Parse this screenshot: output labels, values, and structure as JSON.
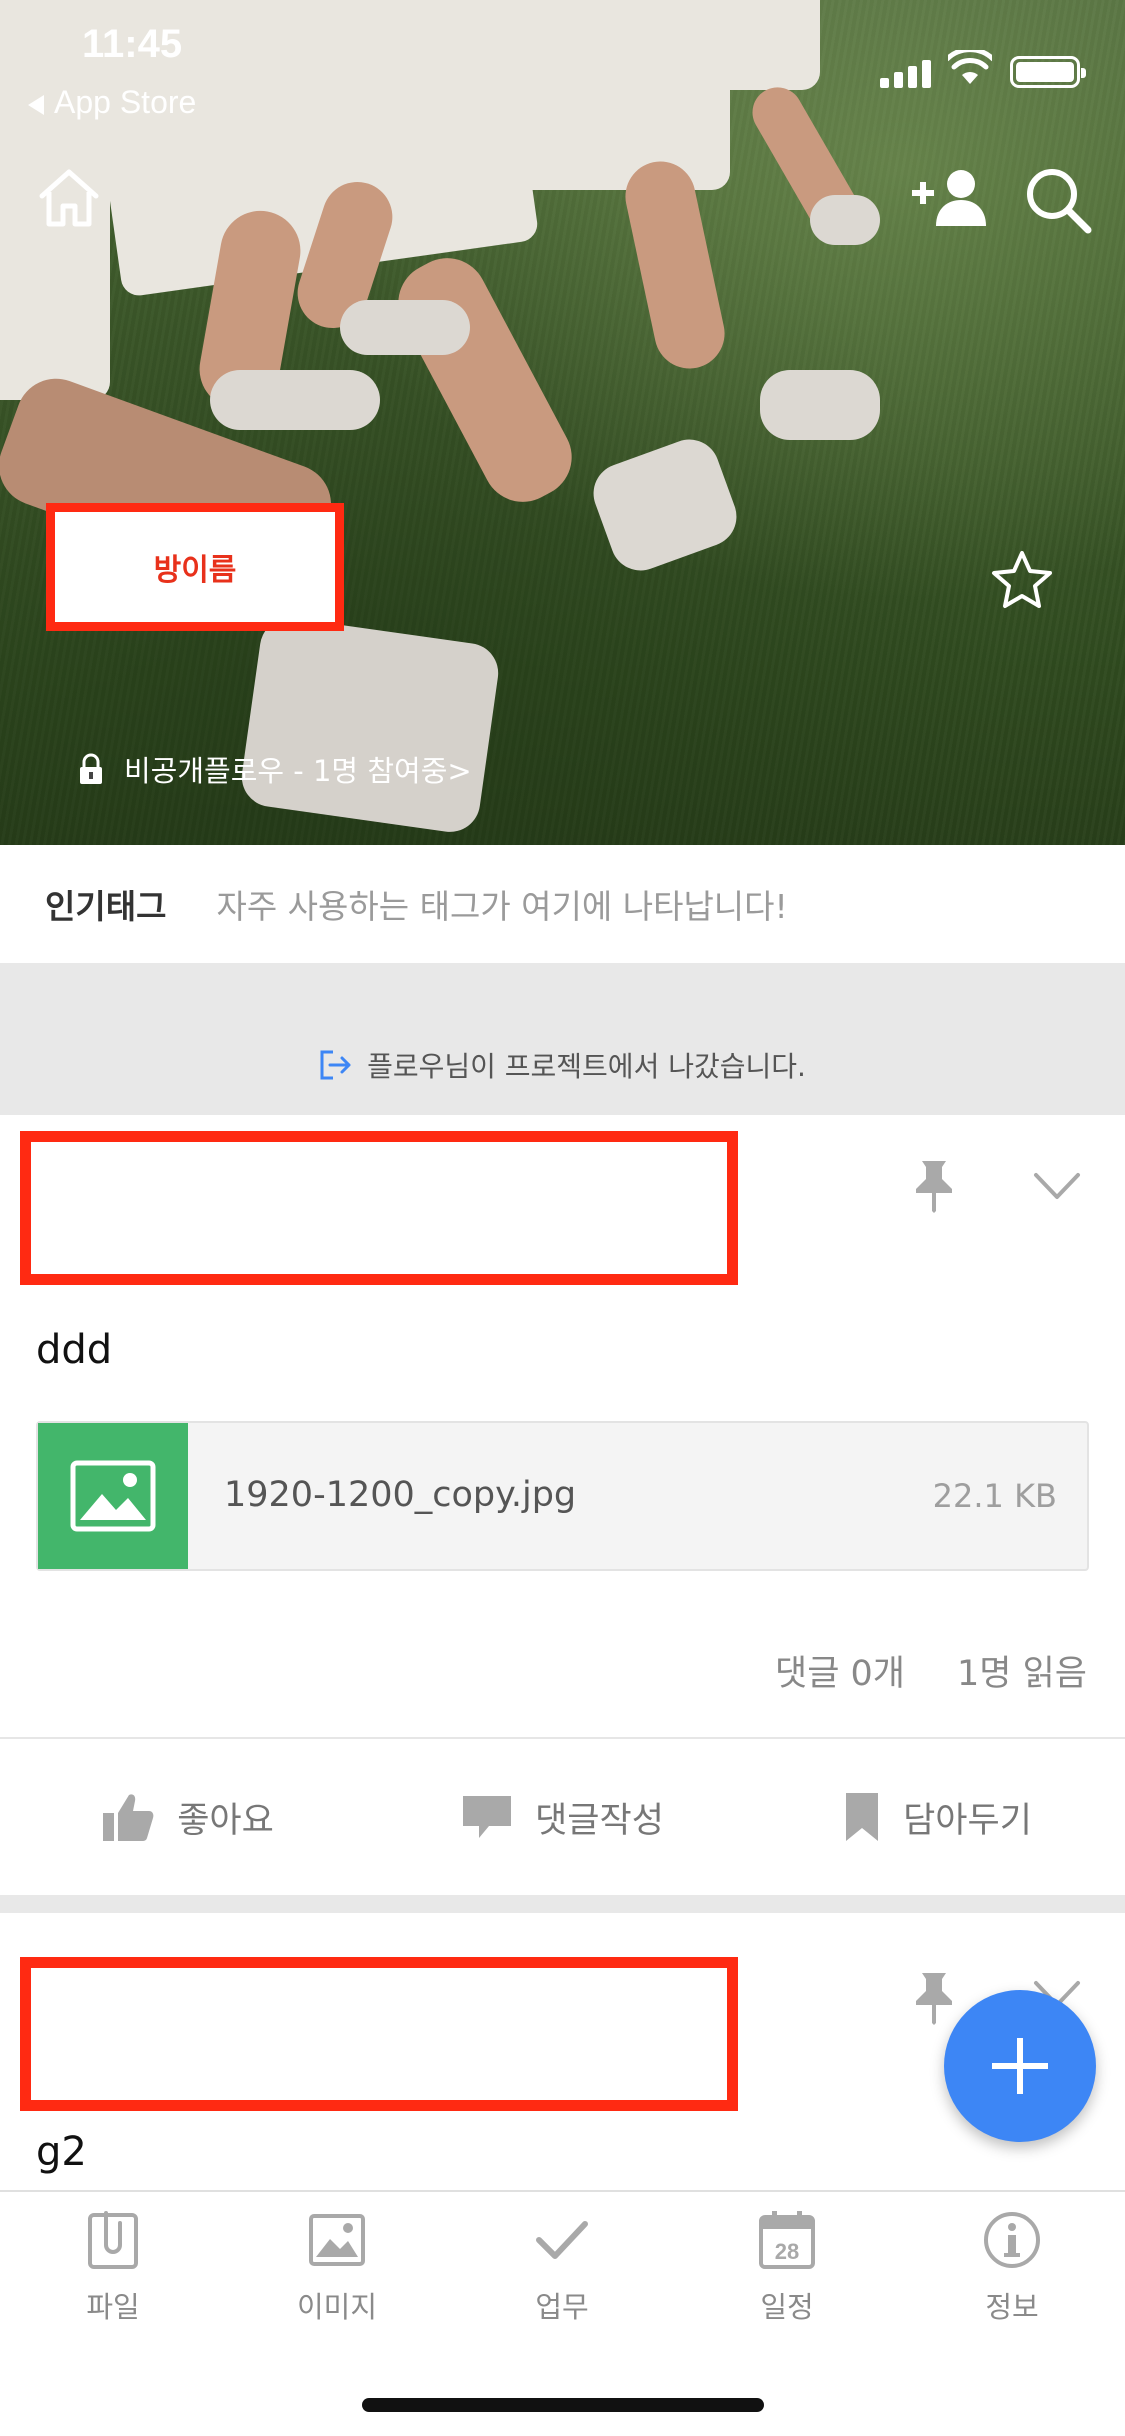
{
  "status_bar": {
    "time": "11:45",
    "back_app": "App Store"
  },
  "header": {
    "room_name": "방이름",
    "room_info": "비공개플로우 - 1명 참여중>"
  },
  "popular_tags": {
    "title": "인기태그",
    "placeholder": "자주 사용하는 태그가 여기에 나타납니다!"
  },
  "notice": "플로우님이 프로젝트에서 나갔습니다.",
  "posts": [
    {
      "text": "ddd",
      "attachment": {
        "name": "1920-1200_copy.jpg",
        "size": "22.1 KB"
      },
      "comments": "댓글 0개",
      "reads": "1명 읽음",
      "actions": {
        "like": "좋아요",
        "comment": "댓글작성",
        "bookmark": "담아두기"
      }
    },
    {
      "text": "g2"
    }
  ],
  "tabbar": {
    "items": [
      {
        "label": "파일",
        "icon": "paperclip-icon"
      },
      {
        "label": "이미지",
        "icon": "image-icon"
      },
      {
        "label": "업무",
        "icon": "checkmark-icon"
      },
      {
        "label": "일정",
        "icon": "calendar-icon",
        "badge": "28"
      },
      {
        "label": "정보",
        "icon": "info-icon"
      }
    ]
  },
  "colors": {
    "accent_blue": "#3d86f5",
    "highlight_red": "#ff2a12",
    "image_green": "#43b66b"
  }
}
